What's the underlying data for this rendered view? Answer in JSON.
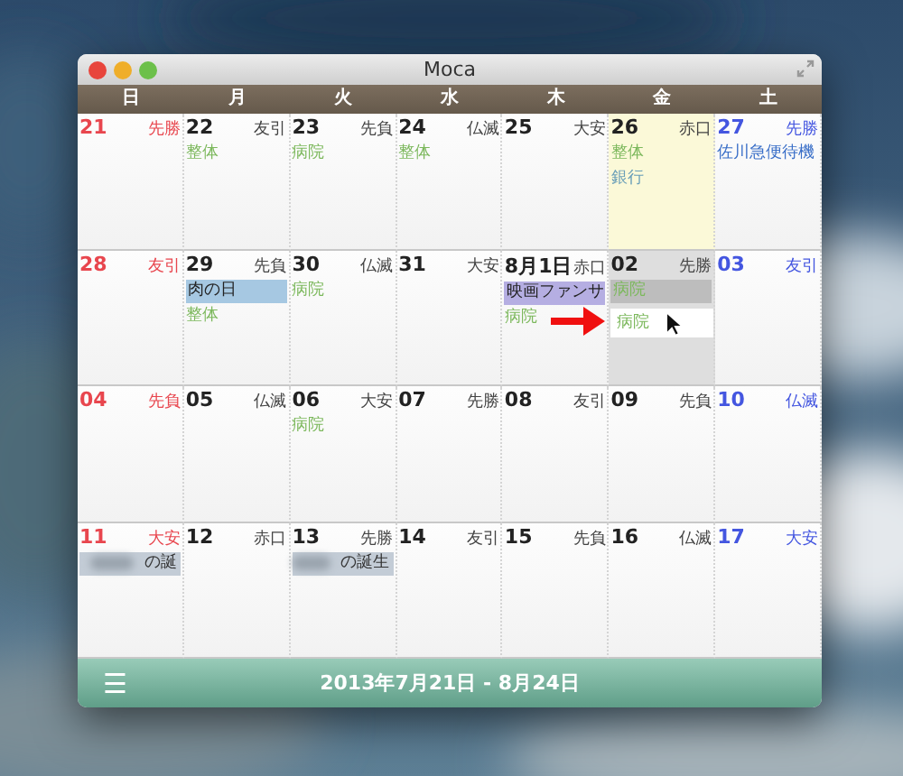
{
  "window": {
    "title": "Moca"
  },
  "weekdays": [
    "日",
    "月",
    "火",
    "水",
    "木",
    "金",
    "土"
  ],
  "weeks": [
    [
      {
        "number": "21",
        "rokuyo": "先勝",
        "today": false,
        "drop_target": false
      },
      {
        "number": "22",
        "rokuyo": "友引",
        "today": false,
        "drop_target": false,
        "events": [
          {
            "text": "整体",
            "kind": "text",
            "color": "#7cb85c"
          }
        ]
      },
      {
        "number": "23",
        "rokuyo": "先負",
        "today": false,
        "drop_target": false,
        "events": [
          {
            "text": "病院",
            "kind": "text",
            "color": "#7cb85c"
          }
        ]
      },
      {
        "number": "24",
        "rokuyo": "仏滅",
        "today": false,
        "drop_target": false,
        "events": [
          {
            "text": "整体",
            "kind": "text",
            "color": "#7cb85c"
          }
        ]
      },
      {
        "number": "25",
        "rokuyo": "大安",
        "today": false,
        "drop_target": false
      },
      {
        "number": "26",
        "rokuyo": "赤口",
        "today": true,
        "drop_target": false,
        "events": [
          {
            "text": "整体",
            "kind": "text",
            "color": "#7cb85c"
          },
          {
            "text": "銀行",
            "kind": "text",
            "color": "#6a9fb8"
          }
        ]
      },
      {
        "number": "27",
        "rokuyo": "先勝",
        "today": false,
        "drop_target": false,
        "events": [
          {
            "text": "佐川急便待機",
            "kind": "text",
            "color": "#3a6fc8"
          }
        ]
      }
    ],
    [
      {
        "number": "28",
        "rokuyo": "友引",
        "today": false,
        "drop_target": false
      },
      {
        "number": "29",
        "rokuyo": "先負",
        "today": false,
        "drop_target": false,
        "events": [
          {
            "text": "肉の日",
            "kind": "bar",
            "color": "#a6c8e2"
          },
          {
            "text": "整体",
            "kind": "text",
            "color": "#7cb85c"
          }
        ]
      },
      {
        "number": "30",
        "rokuyo": "仏滅",
        "today": false,
        "drop_target": false,
        "events": [
          {
            "text": "病院",
            "kind": "text",
            "color": "#7cb85c"
          }
        ]
      },
      {
        "number": "31",
        "rokuyo": "大安",
        "today": false,
        "drop_target": false
      },
      {
        "number": "8月1日",
        "rokuyo": "赤口",
        "today": false,
        "drop_target": false,
        "events": [
          {
            "text": "映画ファンサ",
            "kind": "bar",
            "color": "#b5aee2"
          },
          {
            "text": "病院",
            "kind": "text",
            "color": "#7cb85c"
          }
        ]
      },
      {
        "number": "02",
        "rokuyo": "先勝",
        "today": false,
        "drop_target": true,
        "events": [
          {
            "text": "病院",
            "kind": "muted",
            "color": "#7cb85c"
          },
          {
            "text": "病院",
            "kind": "ghost",
            "color": "#7cb85c"
          }
        ]
      },
      {
        "number": "03",
        "rokuyo": "友引",
        "today": false,
        "drop_target": false
      }
    ],
    [
      {
        "number": "04",
        "rokuyo": "先負",
        "today": false,
        "drop_target": false
      },
      {
        "number": "05",
        "rokuyo": "仏滅",
        "today": false,
        "drop_target": false
      },
      {
        "number": "06",
        "rokuyo": "大安",
        "today": false,
        "drop_target": false,
        "events": [
          {
            "text": "病院",
            "kind": "text",
            "color": "#7cb85c"
          }
        ]
      },
      {
        "number": "07",
        "rokuyo": "先勝",
        "today": false,
        "drop_target": false
      },
      {
        "number": "08",
        "rokuyo": "友引",
        "today": false,
        "drop_target": false
      },
      {
        "number": "09",
        "rokuyo": "先負",
        "today": false,
        "drop_target": false
      },
      {
        "number": "10",
        "rokuyo": "仏滅",
        "today": false,
        "drop_target": false
      }
    ],
    [
      {
        "number": "11",
        "rokuyo": "大安",
        "today": false,
        "drop_target": false,
        "events": [
          {
            "text": "の誕",
            "kind": "blurred",
            "color": "#c3ccd6"
          }
        ]
      },
      {
        "number": "12",
        "rokuyo": "赤口",
        "today": false,
        "drop_target": false
      },
      {
        "number": "13",
        "rokuyo": "先勝",
        "today": false,
        "drop_target": false,
        "events": [
          {
            "text": "の誕生",
            "kind": "blurred",
            "color": "#c3ccd6"
          }
        ]
      },
      {
        "number": "14",
        "rokuyo": "友引",
        "today": false,
        "drop_target": false
      },
      {
        "number": "15",
        "rokuyo": "先負",
        "today": false,
        "drop_target": false
      },
      {
        "number": "16",
        "rokuyo": "仏滅",
        "today": false,
        "drop_target": false
      },
      {
        "number": "17",
        "rokuyo": "大安",
        "today": false,
        "drop_target": false
      }
    ]
  ],
  "footer": {
    "menu_icon": "☰",
    "range": "2013年7月21日 - 8月24日"
  }
}
